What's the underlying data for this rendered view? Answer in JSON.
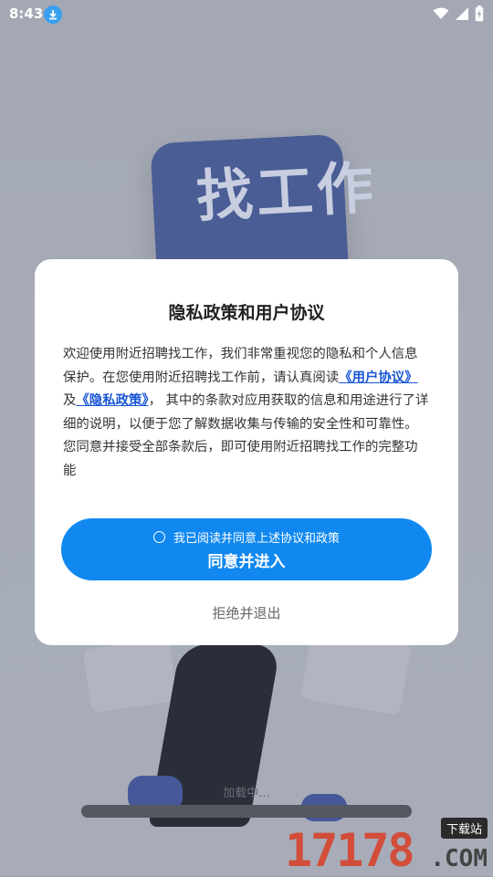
{
  "status_bar": {
    "time": "8:43"
  },
  "background": {
    "card_text": "找工作",
    "loading_text": "加载中..."
  },
  "dialog": {
    "title": "隐私政策和用户协议",
    "body_part1": "欢迎使用附近招聘找工作，我们非常重视您的隐私和个人信息保护。在您使用附近招聘找工作前，请认真阅读",
    "user_agreement_link": "《用户协议》",
    "conjunction": "及",
    "privacy_policy_link": "《隐私政策》",
    "body_part2": "， 其中的条款对应用获取的信息和用途进行了详细的说明，以便于您了解数据收集与传输的安全性和可靠性。您同意并接受全部条款后，即可使用附近招聘找工作的完整功能",
    "checkbox_label": "我已阅读并同意上述协议和政策",
    "agree_button": "同意并进入",
    "reject_button": "拒绝并退出"
  },
  "watermark": {
    "number": "17178",
    "badge": "下载站",
    "domain": ".COM"
  },
  "colors": {
    "accent": "#1088f0",
    "link": "#1a56d6",
    "overlay": "#a3a8b4"
  }
}
